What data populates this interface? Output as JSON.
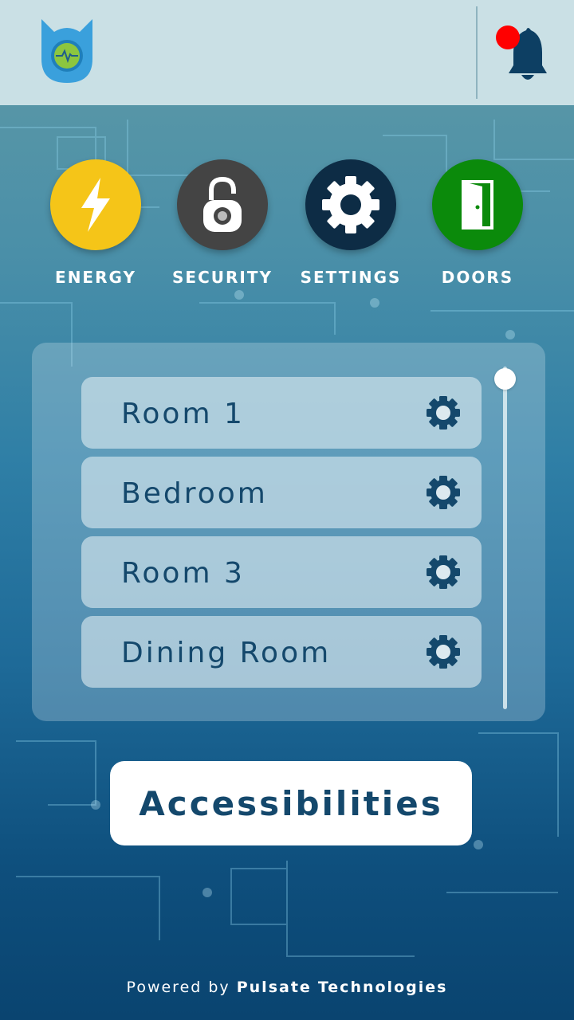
{
  "header": {
    "logo_icon": "shield-heartbeat-logo",
    "notification_icon": "bell-icon",
    "notification_badge_color": "#ff0000"
  },
  "categories": [
    {
      "label": "ENERGY",
      "icon": "lightning-icon",
      "color": "#f5c518"
    },
    {
      "label": "SECURITY",
      "icon": "padlock-icon",
      "color": "#444444"
    },
    {
      "label": "SETTINGS",
      "icon": "gear-icon",
      "color": "#0d2c45"
    },
    {
      "label": "DOORS",
      "icon": "door-icon",
      "color": "#0b8a0b"
    }
  ],
  "rooms": [
    {
      "name": "Room 1",
      "icon": "gear-icon"
    },
    {
      "name": "Bedroom",
      "icon": "gear-icon"
    },
    {
      "name": "Room 3",
      "icon": "gear-icon"
    },
    {
      "name": "Dining Room",
      "icon": "gear-icon"
    }
  ],
  "accessibility_button": "Accessibilities",
  "footer": {
    "prefix": "Powered",
    "by": "by",
    "company_1": "Pulsate",
    "company_2": "Technologies"
  }
}
